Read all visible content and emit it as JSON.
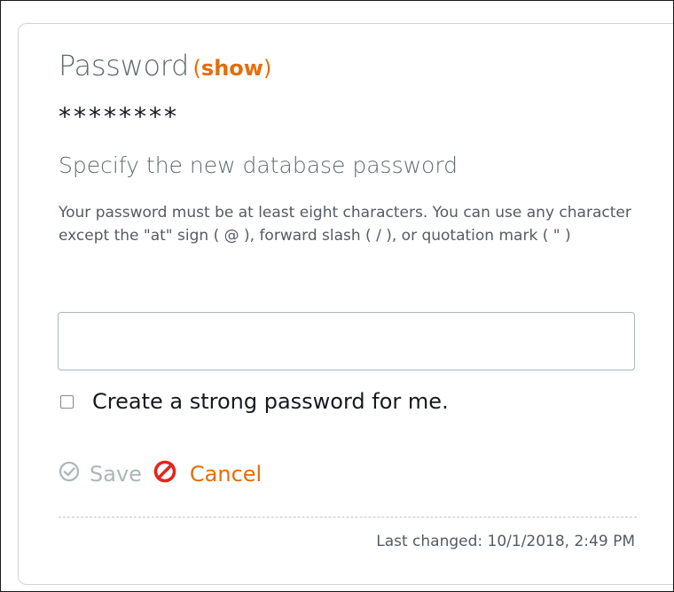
{
  "password_panel": {
    "title": "Password",
    "open_paren": "(",
    "show_link": "show",
    "close_paren": ")",
    "masked_value": "********",
    "heading": "Specify the new database password",
    "hint": "Your password must be at least eight characters. You can use any character except the \"at\" sign ( @ ), forward slash ( / ), or quotation mark ( \" )",
    "input": {
      "value": "",
      "placeholder": ""
    },
    "strong_password_checkbox": {
      "label": "Create a strong password for me.",
      "checked": false
    },
    "actions": {
      "save_label": "Save",
      "save_icon": "check-circle-icon",
      "cancel_label": "Cancel",
      "cancel_icon": "prohibited-icon"
    },
    "last_changed": "Last changed: 10/1/2018, 2:49 PM"
  },
  "colors": {
    "accent": "#e36d0c",
    "disabled": "#aab7b8",
    "text_muted": "#5f6b6d",
    "text": "#16191f"
  }
}
